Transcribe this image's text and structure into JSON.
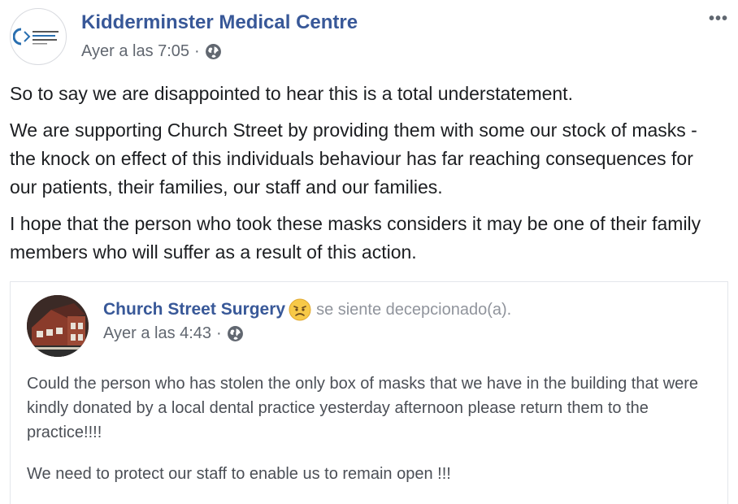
{
  "post": {
    "author": "Kidderminster Medical Centre",
    "timestamp": "Ayer a las 7:05",
    "separator": "·",
    "privacy_icon": "globe-icon",
    "more_label": "•••",
    "paragraphs": [
      "So to say we are disappointed to hear this is a total understatement.",
      "We are supporting Church Street by providing them with some our stock of masks - the knock on effect of this individuals behaviour has far reaching consequences for our patients, their families, our staff and our families.",
      "I hope that the person who took these masks considers it may be one of their family members who will suffer as a result of this action."
    ]
  },
  "shared_post": {
    "author": "Church Street Surgery",
    "feeling_icon": "disappointed-face-icon",
    "feeling": "se siente decepcionado(a).",
    "timestamp": "Ayer a las 4:43",
    "separator": "·",
    "privacy_icon": "globe-icon",
    "paragraphs": [
      "Could the person who has stolen the only box of masks that we have in the building that were kindly donated by a local dental practice yesterday afternoon please return them to the practice!!!!",
      "We need to protect our staff to enable us to remain open !!!"
    ]
  },
  "colors": {
    "link": "#385898",
    "meta": "#616770",
    "text": "#1c1e21",
    "shared_text": "#4b4f56"
  }
}
